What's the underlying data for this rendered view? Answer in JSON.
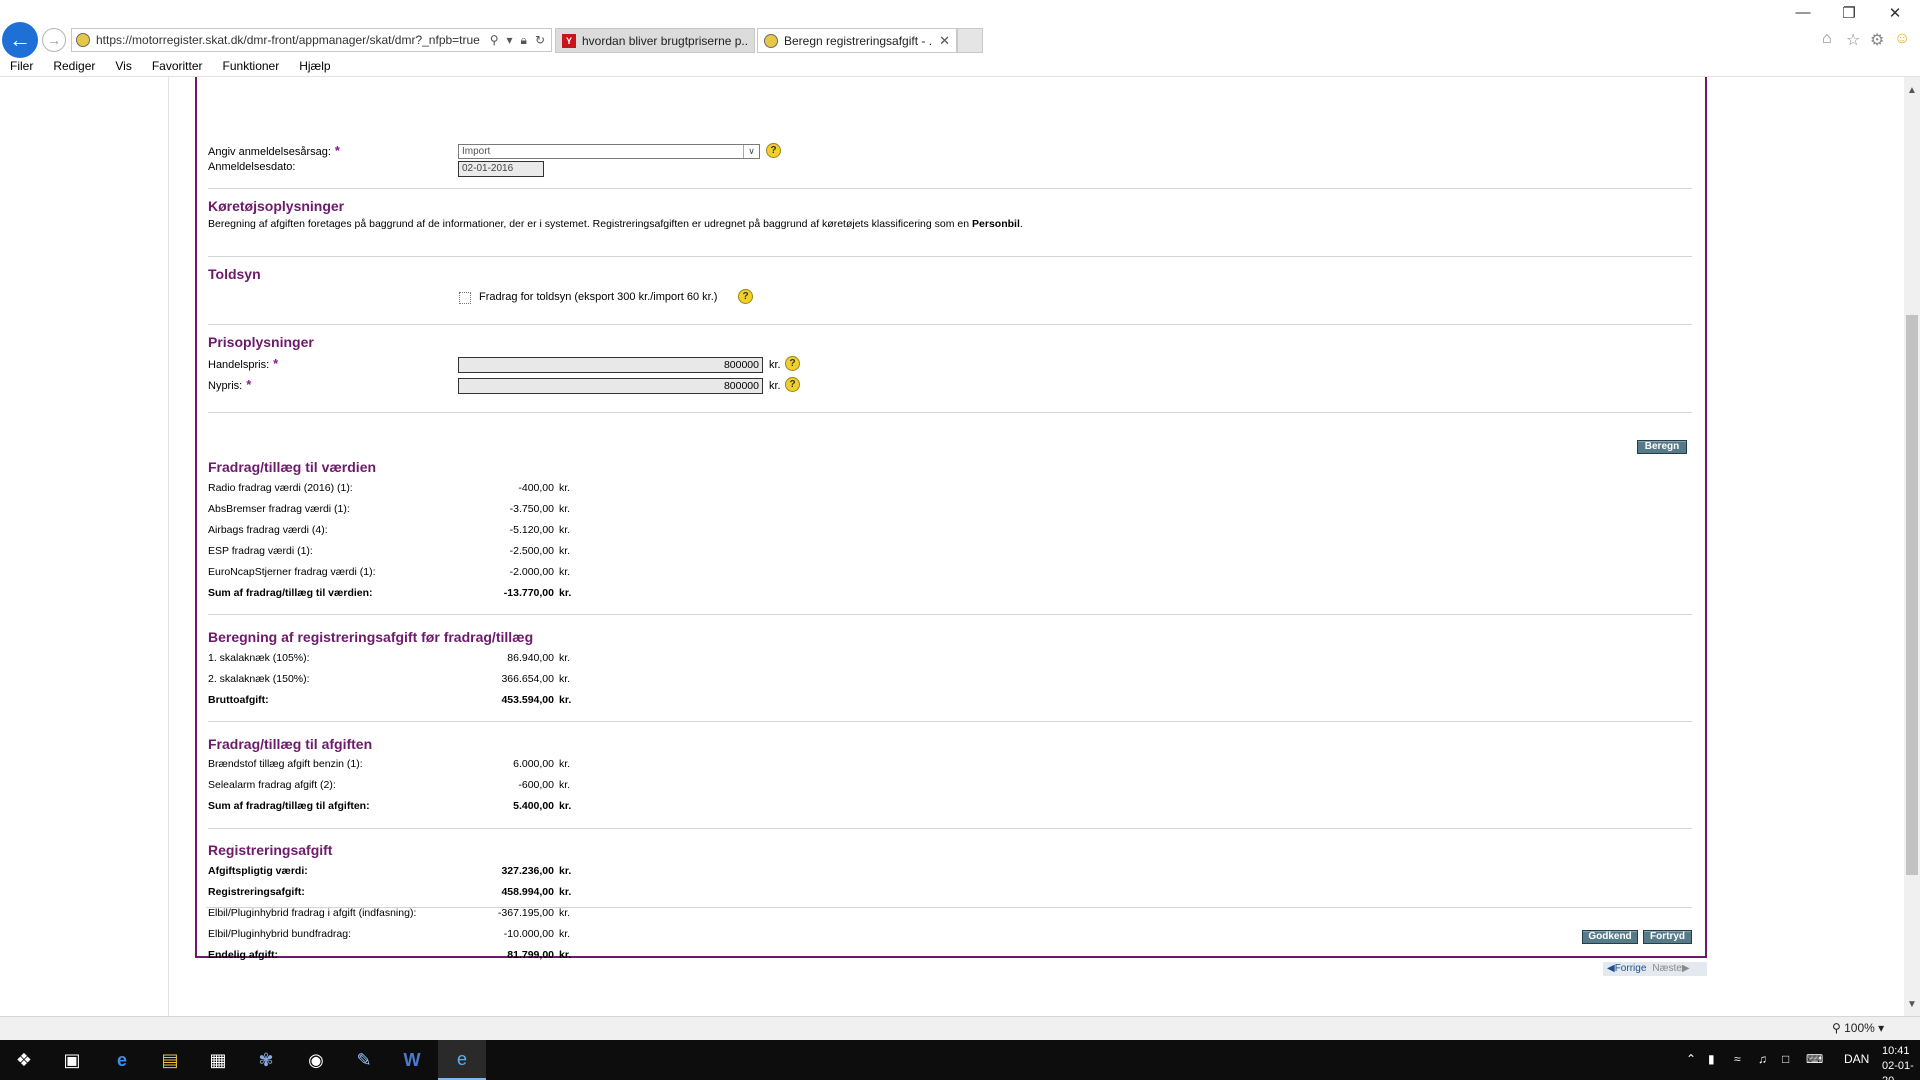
{
  "browser": {
    "url": "https://motorregister.skat.dk/dmr-front/appmanager/skat/dmr?_nfpb=true",
    "tabs": [
      {
        "label": "hvordan bliver brugtpriserne p..."
      },
      {
        "label": "Beregn registreringsafgift - ..."
      }
    ],
    "menu": [
      "Filer",
      "Rediger",
      "Vis",
      "Favoritter",
      "Funktioner",
      "Hjælp"
    ],
    "zoom": "100%"
  },
  "form": {
    "reason_label": "Angiv anmeldelsesårsag:",
    "reason_value": "Import",
    "date_label": "Anmeldelsesdato:",
    "date_value": "02-01-2016",
    "vehicle": {
      "heading": "Køretøjsoplysninger",
      "desc_prefix": "Beregning af afgiften foretages på baggrund af de informationer, der er i systemet. Registreringsafgiften er udregnet på baggrund af køretøjets klassificering som en ",
      "desc_class": "Personbil",
      "desc_suffix": "."
    },
    "toldsyn": {
      "heading": "Toldsyn",
      "checkbox_label": "Fradrag for toldsyn (eksport 300 kr./import 60 kr.)"
    },
    "price": {
      "heading": "Prisoplysninger",
      "trade_label": "Handelspris:",
      "trade_value": "800000",
      "new_label": "Nypris:",
      "new_value": "800000",
      "unit": "kr."
    },
    "calculate_button": "Beregn",
    "value_adjust": {
      "heading": "Fradrag/tillæg til værdien",
      "rows": [
        {
          "label": "Radio fradrag værdi (2016) (1):",
          "value": "-400,00",
          "unit": "kr."
        },
        {
          "label": "AbsBremser fradrag værdi (1):",
          "value": "-3.750,00",
          "unit": "kr."
        },
        {
          "label": "Airbags fradrag værdi (4):",
          "value": "-5.120,00",
          "unit": "kr."
        },
        {
          "label": "ESP fradrag værdi (1):",
          "value": "-2.500,00",
          "unit": "kr."
        },
        {
          "label": "EuroNcapStjerner fradrag værdi (1):",
          "value": "-2.000,00",
          "unit": "kr."
        }
      ],
      "total": {
        "label": "Sum af fradrag/tillæg til værdien:",
        "value": "-13.770,00",
        "unit": "kr."
      }
    },
    "gross": {
      "heading": "Beregning af registreringsafgift før fradrag/tillæg",
      "rows": [
        {
          "label": "1. skalaknæk (105%):",
          "value": "86.940,00",
          "unit": "kr."
        },
        {
          "label": "2. skalaknæk (150%):",
          "value": "366.654,00",
          "unit": "kr."
        }
      ],
      "total": {
        "label": "Bruttoafgift:",
        "value": "453.594,00",
        "unit": "kr."
      }
    },
    "tax_adjust": {
      "heading": "Fradrag/tillæg til afgiften",
      "rows": [
        {
          "label": "Brændstof tillæg afgift benzin (1):",
          "value": "6.000,00",
          "unit": "kr."
        },
        {
          "label": "Selealarm fradrag afgift (2):",
          "value": "-600,00",
          "unit": "kr."
        }
      ],
      "total": {
        "label": "Sum af fradrag/tillæg til afgiften:",
        "value": "5.400,00",
        "unit": "kr."
      }
    },
    "registration": {
      "heading": "Registreringsafgift",
      "rows": [
        {
          "label": "Afgiftspligtig værdi:",
          "value": "327.236,00",
          "unit": "kr.",
          "bold": true
        },
        {
          "label": "Registreringsafgift:",
          "value": "458.994,00",
          "unit": "kr.",
          "bold": true
        },
        {
          "label": "Elbil/Pluginhybrid fradrag i afgift (indfasning):",
          "value": "-367.195,00",
          "unit": "kr.",
          "bold": false
        },
        {
          "label": "Elbil/Pluginhybrid bundfradrag:",
          "value": "-10.000,00",
          "unit": "kr.",
          "bold": false
        },
        {
          "label": "Endelig afgift:",
          "value": "81.799,00",
          "unit": "kr.",
          "bold": true
        }
      ]
    },
    "approve_button": "Godkend",
    "cancel_button": "Fortryd",
    "pager_prev": "Forrige",
    "pager_next": "Næste"
  },
  "taskbar": {
    "language": "DAN",
    "time": "10:41",
    "date": "02-01-20"
  }
}
